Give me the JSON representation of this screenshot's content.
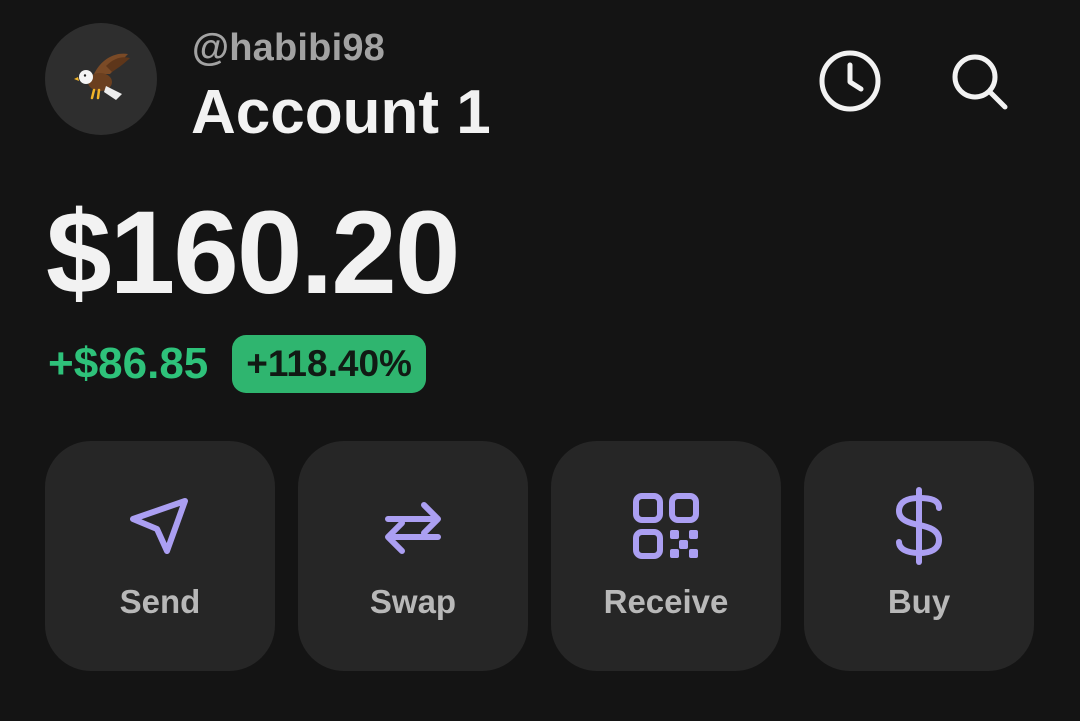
{
  "header": {
    "username": "@habibi98",
    "account_name": "Account 1",
    "avatar_icon": "eagle-icon",
    "history_icon": "clock-icon",
    "search_icon": "search-icon"
  },
  "balance": {
    "total": "$160.20",
    "change_amount": "+$86.85",
    "change_percent": "+118.40%",
    "positive_color": "#2ec27a"
  },
  "actions": [
    {
      "label": "Send",
      "icon": "send-icon"
    },
    {
      "label": "Swap",
      "icon": "swap-icon"
    },
    {
      "label": "Receive",
      "icon": "qr-code-icon"
    },
    {
      "label": "Buy",
      "icon": "dollar-icon"
    }
  ],
  "colors": {
    "background": "#141414",
    "card": "#262626",
    "accent": "#ab9ff2",
    "positive_pill": "#2fb56f"
  }
}
